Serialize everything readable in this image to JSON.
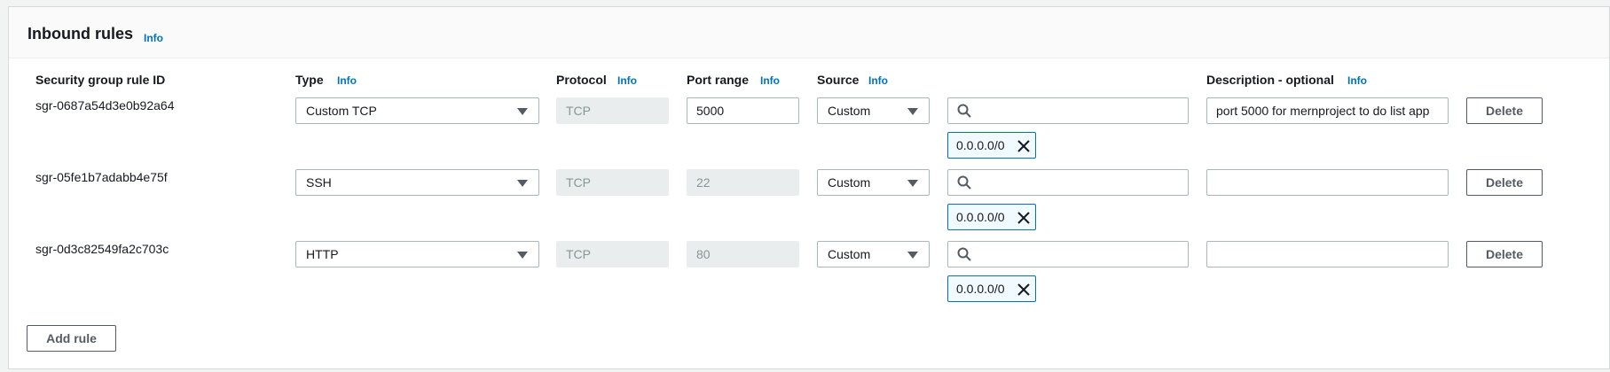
{
  "panel": {
    "title": "Inbound rules",
    "info": "Info"
  },
  "columns": {
    "rule_id": "Security group rule ID",
    "type": "Type",
    "type_info": "Info",
    "protocol": "Protocol",
    "protocol_info": "Info",
    "port_range": "Port range",
    "port_info": "Info",
    "source": "Source",
    "source_info": "Info",
    "description": "Description - optional",
    "description_info": "Info"
  },
  "rules": [
    {
      "id": "sgr-0687a54d3e0b92a64",
      "type": "Custom TCP",
      "protocol": "TCP",
      "port": "5000",
      "source": "Custom",
      "cidr": "0.0.0.0/0",
      "description": "port 5000 for mernproject to do list app",
      "delete": "Delete"
    },
    {
      "id": "sgr-05fe1b7adabb4e75f",
      "type": "SSH",
      "protocol": "TCP",
      "port": "22",
      "source": "Custom",
      "cidr": "0.0.0.0/0",
      "description": "",
      "delete": "Delete"
    },
    {
      "id": "sgr-0d3c82549fa2c703c",
      "type": "HTTP",
      "protocol": "TCP",
      "port": "80",
      "source": "Custom",
      "cidr": "0.0.0.0/0",
      "description": "",
      "delete": "Delete"
    }
  ],
  "footer": {
    "add_rule": "Add rule"
  },
  "colors": {
    "link": "#0073bb",
    "token_border": "#0073bb",
    "token_bg": "#f1faff"
  }
}
